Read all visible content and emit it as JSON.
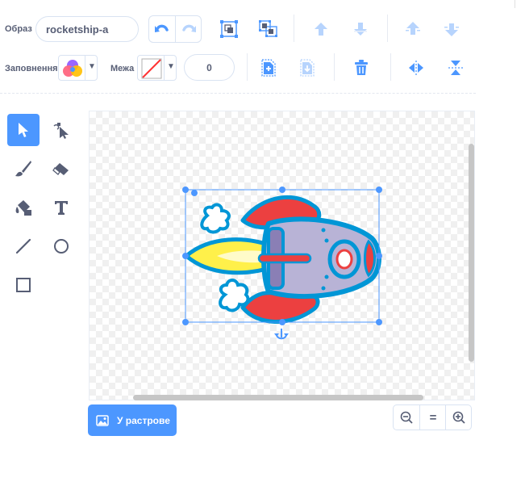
{
  "toolbar": {
    "costume_label": "Образ",
    "costume_name": "rocketship-a",
    "fill_label": "Заповнення",
    "outline_label": "Межа",
    "outline_width": "0",
    "buttons": [
      "undo-icon",
      "redo-icon",
      "group-icon",
      "ungroup-icon",
      "forward-icon",
      "backward-icon",
      "front-icon",
      "back-icon",
      "copy-icon",
      "paste-icon",
      "delete-icon",
      "flip-horizontal-icon",
      "flip-vertical-icon"
    ]
  },
  "tools": [
    "select",
    "reshape",
    "brush",
    "eraser",
    "fill",
    "text",
    "line",
    "circle",
    "rectangle"
  ],
  "canvas": {
    "selected_tool": "select"
  },
  "footer": {
    "bitmap_button_label": "У растрове",
    "zoom_reset_label": "="
  },
  "colors": {
    "accent": "#4c97ff",
    "text": "#575e75",
    "rocket_outline": "#0096d6",
    "rocket_body": "#b8b3d6",
    "rocket_red": "#ec4040",
    "flame_yellow": "#fff04a"
  }
}
